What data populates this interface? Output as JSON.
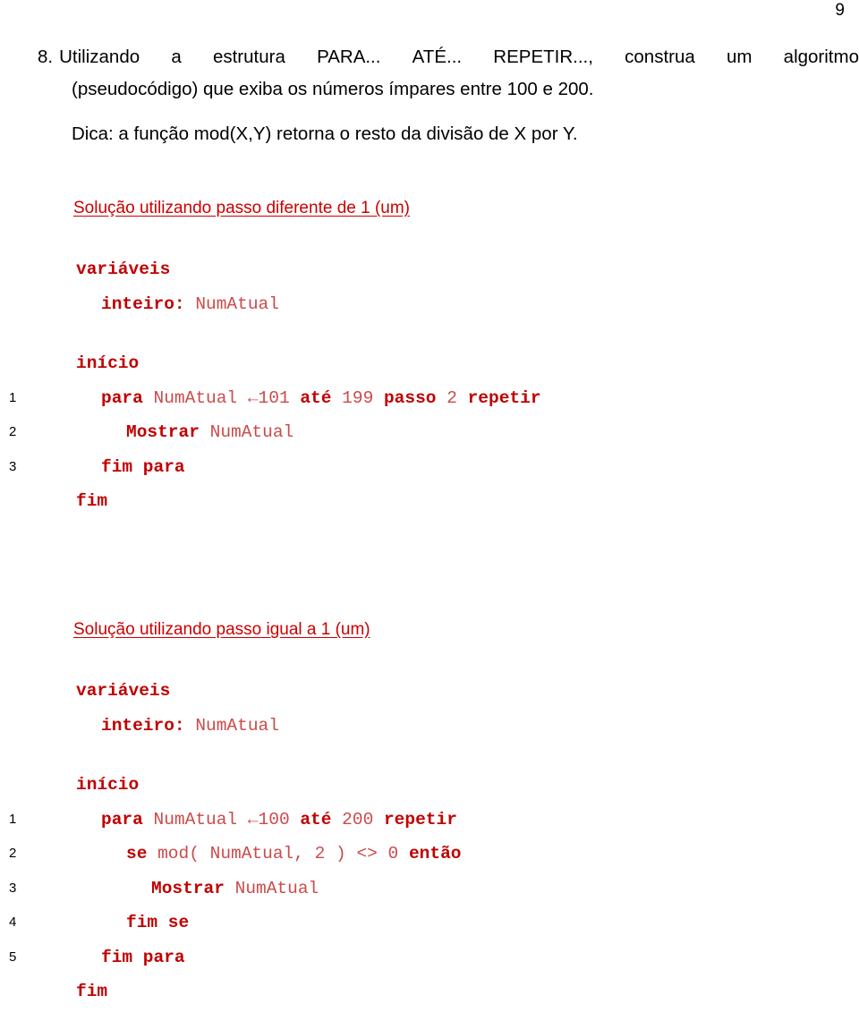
{
  "page": {
    "number": "9"
  },
  "question": {
    "marker": "8.",
    "line1_words": [
      "Utilizando",
      "a",
      "estrutura",
      "PARA...",
      "ATÉ...",
      "REPETIR...,",
      "construa",
      "um",
      "algoritmo"
    ],
    "line2": "(pseudocódigo) que exiba os números ímpares entre 100 e 200.",
    "line3": "Dica: a função mod(X,Y) retorna o resto da divisão de X por Y."
  },
  "sections": [
    {
      "heading": "Solução utilizando passo diferente de 1 (um)",
      "lines": [
        {
          "no": "",
          "indent": 0,
          "gap": false,
          "tokens": [
            {
              "t": "variáveis",
              "c": "kw"
            }
          ]
        },
        {
          "no": "",
          "indent": 1,
          "gap": false,
          "tokens": [
            {
              "t": "inteiro:",
              "c": "kw"
            },
            {
              "t": " ",
              "c": "op"
            },
            {
              "t": "NumAtual",
              "c": "id"
            }
          ]
        },
        {
          "no": "",
          "indent": 0,
          "gap": true,
          "tokens": [
            {
              "t": "início",
              "c": "kw"
            }
          ]
        },
        {
          "no": "1",
          "indent": 1,
          "gap": false,
          "tokens": [
            {
              "t": "para",
              "c": "kw"
            },
            {
              "t": " ",
              "c": "op"
            },
            {
              "t": "NumAtual",
              "c": "id"
            },
            {
              "t": " ←",
              "c": "op"
            },
            {
              "t": "101",
              "c": "num"
            },
            {
              "t": " ",
              "c": "op"
            },
            {
              "t": "até",
              "c": "kw"
            },
            {
              "t": " ",
              "c": "op"
            },
            {
              "t": "199",
              "c": "num"
            },
            {
              "t": " ",
              "c": "op"
            },
            {
              "t": "passo",
              "c": "kw"
            },
            {
              "t": " ",
              "c": "op"
            },
            {
              "t": "2",
              "c": "num"
            },
            {
              "t": " ",
              "c": "op"
            },
            {
              "t": "repetir",
              "c": "kw"
            }
          ]
        },
        {
          "no": "2",
          "indent": 2,
          "gap": false,
          "tokens": [
            {
              "t": "Mostrar",
              "c": "kw"
            },
            {
              "t": " ",
              "c": "op"
            },
            {
              "t": "NumAtual",
              "c": "id"
            }
          ]
        },
        {
          "no": "3",
          "indent": 1,
          "gap": false,
          "tokens": [
            {
              "t": "fim para",
              "c": "kw"
            }
          ]
        },
        {
          "no": "",
          "indent": 0,
          "gap": false,
          "tokens": [
            {
              "t": "fim",
              "c": "kw"
            }
          ]
        }
      ]
    },
    {
      "heading": "Solução utilizando passo igual a 1 (um)",
      "lines": [
        {
          "no": "",
          "indent": 0,
          "gap": false,
          "tokens": [
            {
              "t": "variáveis",
              "c": "kw"
            }
          ]
        },
        {
          "no": "",
          "indent": 1,
          "gap": false,
          "tokens": [
            {
              "t": "inteiro:",
              "c": "kw"
            },
            {
              "t": " ",
              "c": "op"
            },
            {
              "t": "NumAtual",
              "c": "id"
            }
          ]
        },
        {
          "no": "",
          "indent": 0,
          "gap": true,
          "tokens": [
            {
              "t": "início",
              "c": "kw"
            }
          ]
        },
        {
          "no": "1",
          "indent": 1,
          "gap": false,
          "tokens": [
            {
              "t": "para",
              "c": "kw"
            },
            {
              "t": " ",
              "c": "op"
            },
            {
              "t": "NumAtual",
              "c": "id"
            },
            {
              "t": " ←",
              "c": "op"
            },
            {
              "t": "100",
              "c": "num"
            },
            {
              "t": " ",
              "c": "op"
            },
            {
              "t": "até",
              "c": "kw"
            },
            {
              "t": " ",
              "c": "op"
            },
            {
              "t": "200",
              "c": "num"
            },
            {
              "t": " ",
              "c": "op"
            },
            {
              "t": "repetir",
              "c": "kw"
            }
          ]
        },
        {
          "no": "2",
          "indent": 2,
          "gap": false,
          "tokens": [
            {
              "t": "se",
              "c": "kw"
            },
            {
              "t": " ",
              "c": "op"
            },
            {
              "t": "mod( NumAtual, 2 ) <> 0",
              "c": "id"
            },
            {
              "t": " ",
              "c": "op"
            },
            {
              "t": "então",
              "c": "kw"
            }
          ]
        },
        {
          "no": "3",
          "indent": 3,
          "gap": false,
          "tokens": [
            {
              "t": "Mostrar",
              "c": "kw"
            },
            {
              "t": " ",
              "c": "op"
            },
            {
              "t": "NumAtual",
              "c": "id"
            }
          ]
        },
        {
          "no": "4",
          "indent": 2,
          "gap": false,
          "tokens": [
            {
              "t": "fim se",
              "c": "kw"
            }
          ]
        },
        {
          "no": "5",
          "indent": 1,
          "gap": false,
          "tokens": [
            {
              "t": "fim para",
              "c": "kw"
            }
          ]
        },
        {
          "no": "",
          "indent": 0,
          "gap": false,
          "tokens": [
            {
              "t": "fim",
              "c": "kw"
            }
          ]
        }
      ]
    }
  ],
  "colors": {
    "keyword": "#C00000",
    "identifier": "#CC4A4A",
    "heading": "#CC0000",
    "body_text": "#000000",
    "background": "#FFFFFF"
  }
}
